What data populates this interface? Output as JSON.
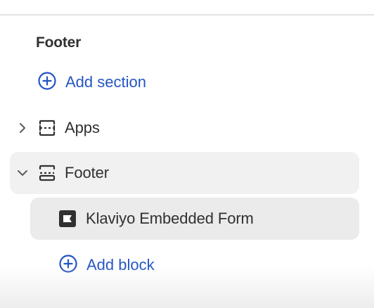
{
  "footer_group": {
    "title": "Footer",
    "add_section_label": "Add section",
    "sections": [
      {
        "label": "Apps",
        "icon": "section-icon",
        "expanded": false
      },
      {
        "label": "Footer",
        "icon": "section-icon",
        "expanded": true,
        "blocks": [
          {
            "label": "Klaviyo Embedded Form",
            "icon": "app-block-icon"
          }
        ],
        "add_block_label": "Add block"
      }
    ]
  },
  "colors": {
    "link": "#2455c3",
    "text": "#303030",
    "selected_bg": "#ebebeb",
    "hover_bg": "#f1f1f1"
  }
}
